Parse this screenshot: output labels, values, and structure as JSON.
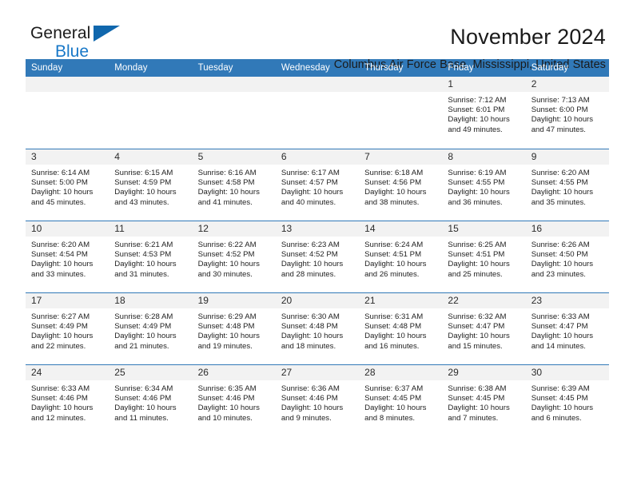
{
  "brand": {
    "name_part1": "General",
    "name_part2": "Blue",
    "triangle_color": "#1067ad",
    "blue_color": "#1878c8"
  },
  "header": {
    "title": "November 2024",
    "subtitle": "Columbus Air Force Base, Mississippi, United States"
  },
  "theme": {
    "header_blue": "#3179b8",
    "day_band_gray": "#f2f2f2",
    "text_color": "#222222"
  },
  "weekdays": [
    "Sunday",
    "Monday",
    "Tuesday",
    "Wednesday",
    "Thursday",
    "Friday",
    "Saturday"
  ],
  "weeks": [
    [
      {
        "day": "",
        "sunrise": "",
        "sunset": "",
        "daylight_line1": "",
        "daylight_line2": ""
      },
      {
        "day": "",
        "sunrise": "",
        "sunset": "",
        "daylight_line1": "",
        "daylight_line2": ""
      },
      {
        "day": "",
        "sunrise": "",
        "sunset": "",
        "daylight_line1": "",
        "daylight_line2": ""
      },
      {
        "day": "",
        "sunrise": "",
        "sunset": "",
        "daylight_line1": "",
        "daylight_line2": ""
      },
      {
        "day": "",
        "sunrise": "",
        "sunset": "",
        "daylight_line1": "",
        "daylight_line2": ""
      },
      {
        "day": "1",
        "sunrise": "Sunrise: 7:12 AM",
        "sunset": "Sunset: 6:01 PM",
        "daylight_line1": "Daylight: 10 hours",
        "daylight_line2": "and 49 minutes."
      },
      {
        "day": "2",
        "sunrise": "Sunrise: 7:13 AM",
        "sunset": "Sunset: 6:00 PM",
        "daylight_line1": "Daylight: 10 hours",
        "daylight_line2": "and 47 minutes."
      }
    ],
    [
      {
        "day": "3",
        "sunrise": "Sunrise: 6:14 AM",
        "sunset": "Sunset: 5:00 PM",
        "daylight_line1": "Daylight: 10 hours",
        "daylight_line2": "and 45 minutes."
      },
      {
        "day": "4",
        "sunrise": "Sunrise: 6:15 AM",
        "sunset": "Sunset: 4:59 PM",
        "daylight_line1": "Daylight: 10 hours",
        "daylight_line2": "and 43 minutes."
      },
      {
        "day": "5",
        "sunrise": "Sunrise: 6:16 AM",
        "sunset": "Sunset: 4:58 PM",
        "daylight_line1": "Daylight: 10 hours",
        "daylight_line2": "and 41 minutes."
      },
      {
        "day": "6",
        "sunrise": "Sunrise: 6:17 AM",
        "sunset": "Sunset: 4:57 PM",
        "daylight_line1": "Daylight: 10 hours",
        "daylight_line2": "and 40 minutes."
      },
      {
        "day": "7",
        "sunrise": "Sunrise: 6:18 AM",
        "sunset": "Sunset: 4:56 PM",
        "daylight_line1": "Daylight: 10 hours",
        "daylight_line2": "and 38 minutes."
      },
      {
        "day": "8",
        "sunrise": "Sunrise: 6:19 AM",
        "sunset": "Sunset: 4:55 PM",
        "daylight_line1": "Daylight: 10 hours",
        "daylight_line2": "and 36 minutes."
      },
      {
        "day": "9",
        "sunrise": "Sunrise: 6:20 AM",
        "sunset": "Sunset: 4:55 PM",
        "daylight_line1": "Daylight: 10 hours",
        "daylight_line2": "and 35 minutes."
      }
    ],
    [
      {
        "day": "10",
        "sunrise": "Sunrise: 6:20 AM",
        "sunset": "Sunset: 4:54 PM",
        "daylight_line1": "Daylight: 10 hours",
        "daylight_line2": "and 33 minutes."
      },
      {
        "day": "11",
        "sunrise": "Sunrise: 6:21 AM",
        "sunset": "Sunset: 4:53 PM",
        "daylight_line1": "Daylight: 10 hours",
        "daylight_line2": "and 31 minutes."
      },
      {
        "day": "12",
        "sunrise": "Sunrise: 6:22 AM",
        "sunset": "Sunset: 4:52 PM",
        "daylight_line1": "Daylight: 10 hours",
        "daylight_line2": "and 30 minutes."
      },
      {
        "day": "13",
        "sunrise": "Sunrise: 6:23 AM",
        "sunset": "Sunset: 4:52 PM",
        "daylight_line1": "Daylight: 10 hours",
        "daylight_line2": "and 28 minutes."
      },
      {
        "day": "14",
        "sunrise": "Sunrise: 6:24 AM",
        "sunset": "Sunset: 4:51 PM",
        "daylight_line1": "Daylight: 10 hours",
        "daylight_line2": "and 26 minutes."
      },
      {
        "day": "15",
        "sunrise": "Sunrise: 6:25 AM",
        "sunset": "Sunset: 4:51 PM",
        "daylight_line1": "Daylight: 10 hours",
        "daylight_line2": "and 25 minutes."
      },
      {
        "day": "16",
        "sunrise": "Sunrise: 6:26 AM",
        "sunset": "Sunset: 4:50 PM",
        "daylight_line1": "Daylight: 10 hours",
        "daylight_line2": "and 23 minutes."
      }
    ],
    [
      {
        "day": "17",
        "sunrise": "Sunrise: 6:27 AM",
        "sunset": "Sunset: 4:49 PM",
        "daylight_line1": "Daylight: 10 hours",
        "daylight_line2": "and 22 minutes."
      },
      {
        "day": "18",
        "sunrise": "Sunrise: 6:28 AM",
        "sunset": "Sunset: 4:49 PM",
        "daylight_line1": "Daylight: 10 hours",
        "daylight_line2": "and 21 minutes."
      },
      {
        "day": "19",
        "sunrise": "Sunrise: 6:29 AM",
        "sunset": "Sunset: 4:48 PM",
        "daylight_line1": "Daylight: 10 hours",
        "daylight_line2": "and 19 minutes."
      },
      {
        "day": "20",
        "sunrise": "Sunrise: 6:30 AM",
        "sunset": "Sunset: 4:48 PM",
        "daylight_line1": "Daylight: 10 hours",
        "daylight_line2": "and 18 minutes."
      },
      {
        "day": "21",
        "sunrise": "Sunrise: 6:31 AM",
        "sunset": "Sunset: 4:48 PM",
        "daylight_line1": "Daylight: 10 hours",
        "daylight_line2": "and 16 minutes."
      },
      {
        "day": "22",
        "sunrise": "Sunrise: 6:32 AM",
        "sunset": "Sunset: 4:47 PM",
        "daylight_line1": "Daylight: 10 hours",
        "daylight_line2": "and 15 minutes."
      },
      {
        "day": "23",
        "sunrise": "Sunrise: 6:33 AM",
        "sunset": "Sunset: 4:47 PM",
        "daylight_line1": "Daylight: 10 hours",
        "daylight_line2": "and 14 minutes."
      }
    ],
    [
      {
        "day": "24",
        "sunrise": "Sunrise: 6:33 AM",
        "sunset": "Sunset: 4:46 PM",
        "daylight_line1": "Daylight: 10 hours",
        "daylight_line2": "and 12 minutes."
      },
      {
        "day": "25",
        "sunrise": "Sunrise: 6:34 AM",
        "sunset": "Sunset: 4:46 PM",
        "daylight_line1": "Daylight: 10 hours",
        "daylight_line2": "and 11 minutes."
      },
      {
        "day": "26",
        "sunrise": "Sunrise: 6:35 AM",
        "sunset": "Sunset: 4:46 PM",
        "daylight_line1": "Daylight: 10 hours",
        "daylight_line2": "and 10 minutes."
      },
      {
        "day": "27",
        "sunrise": "Sunrise: 6:36 AM",
        "sunset": "Sunset: 4:46 PM",
        "daylight_line1": "Daylight: 10 hours",
        "daylight_line2": "and 9 minutes."
      },
      {
        "day": "28",
        "sunrise": "Sunrise: 6:37 AM",
        "sunset": "Sunset: 4:45 PM",
        "daylight_line1": "Daylight: 10 hours",
        "daylight_line2": "and 8 minutes."
      },
      {
        "day": "29",
        "sunrise": "Sunrise: 6:38 AM",
        "sunset": "Sunset: 4:45 PM",
        "daylight_line1": "Daylight: 10 hours",
        "daylight_line2": "and 7 minutes."
      },
      {
        "day": "30",
        "sunrise": "Sunrise: 6:39 AM",
        "sunset": "Sunset: 4:45 PM",
        "daylight_line1": "Daylight: 10 hours",
        "daylight_line2": "and 6 minutes."
      }
    ]
  ]
}
